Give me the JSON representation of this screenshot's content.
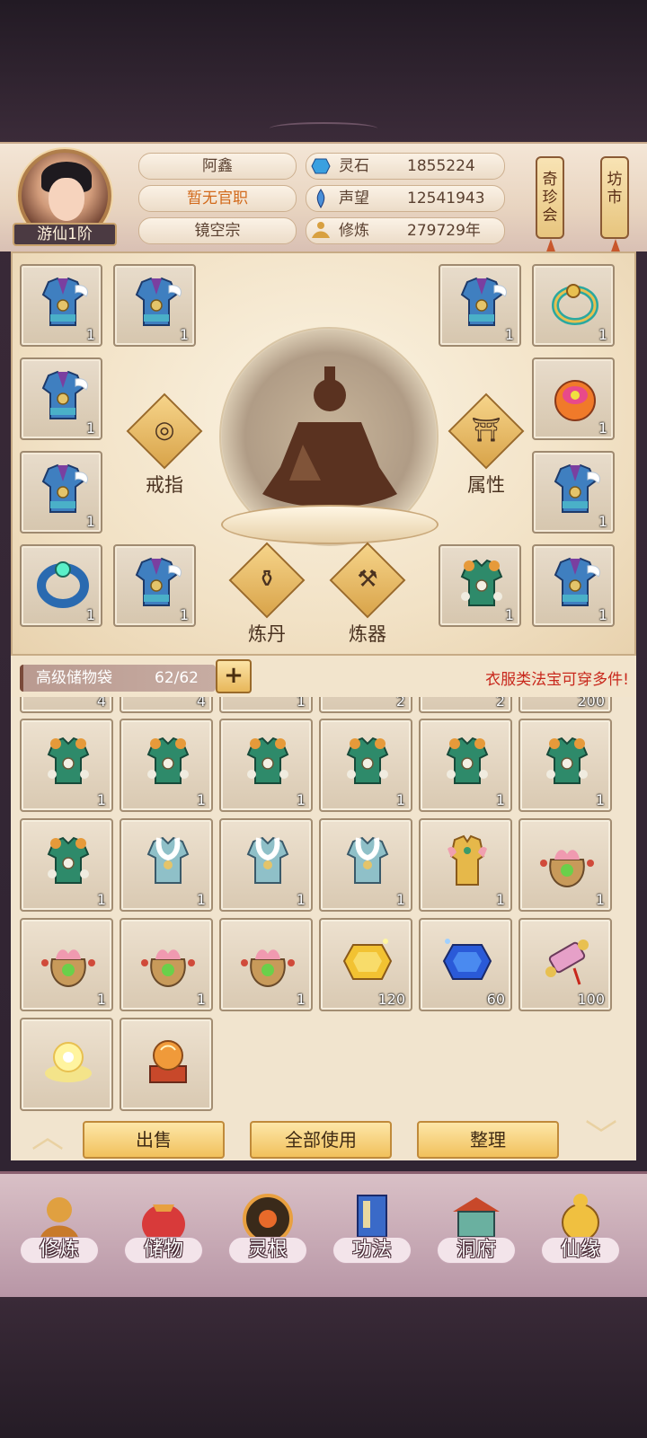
{
  "player": {
    "name": "阿鑫",
    "title": "暂无官职",
    "sect": "镜空宗",
    "rank": "游仙1阶"
  },
  "resources": [
    {
      "icon": "spirit-stone-icon",
      "label": "灵石",
      "value": "1855224",
      "color": "#3aa0e0"
    },
    {
      "icon": "reputation-icon",
      "label": "声望",
      "value": "12541943",
      "color": "#4a8fd8"
    },
    {
      "icon": "cultivate-icon",
      "label": "修炼",
      "value": "279729年",
      "color": "#d8a040"
    }
  ],
  "shops": {
    "treasure": "奇珍会",
    "market": "坊市"
  },
  "equipment": {
    "slots": [
      {
        "icon": "robe-blue-icon",
        "count": "1"
      },
      {
        "icon": "robe-blue-icon",
        "count": "1"
      },
      {
        "icon": "robe-blue-icon",
        "count": "1"
      },
      {
        "icon": "ring-gold-icon",
        "count": "1"
      },
      {
        "icon": "robe-blue-icon",
        "count": "1"
      },
      {
        "icon": "pouch-orange-icon",
        "count": "1"
      },
      {
        "icon": "robe-blue-icon",
        "count": "1"
      },
      {
        "icon": "robe-blue-icon",
        "count": "1"
      },
      {
        "icon": "ring-jade-icon",
        "count": "1"
      },
      {
        "icon": "robe-blue-icon",
        "count": "1"
      },
      {
        "icon": "robe-green-icon",
        "count": "1"
      },
      {
        "icon": "robe-blue-icon",
        "count": "1"
      }
    ],
    "actions": {
      "ring": "戒指",
      "attribute": "属性",
      "alchemy": "炼丹",
      "forge": "炼器"
    }
  },
  "bag": {
    "name": "高级储物袋",
    "capacity": "62/62",
    "tip": "衣服类法宝可穿多件!"
  },
  "inventory": {
    "top_counts": [
      "4",
      "4",
      "1",
      "2",
      "2",
      "200"
    ],
    "rows": [
      [
        {
          "icon": "robe-green-icon",
          "count": "1"
        },
        {
          "icon": "robe-green-icon",
          "count": "1"
        },
        {
          "icon": "robe-green-icon",
          "count": "1"
        },
        {
          "icon": "robe-green-icon",
          "count": "1"
        },
        {
          "icon": "robe-green-icon",
          "count": "1"
        },
        {
          "icon": "robe-green-icon",
          "count": "1"
        }
      ],
      [
        {
          "icon": "robe-green-icon",
          "count": "1"
        },
        {
          "icon": "robe-white-icon",
          "count": "1"
        },
        {
          "icon": "robe-white-icon",
          "count": "1"
        },
        {
          "icon": "robe-white-icon",
          "count": "1"
        },
        {
          "icon": "robe-gold-icon",
          "count": "1"
        },
        {
          "icon": "pouch-lotus-icon",
          "count": "1"
        }
      ],
      [
        {
          "icon": "pouch-lotus-icon",
          "count": "1"
        },
        {
          "icon": "pouch-lotus-icon",
          "count": "1"
        },
        {
          "icon": "pouch-lotus-icon",
          "count": "1"
        },
        {
          "icon": "gem-gold-icon",
          "count": "120"
        },
        {
          "icon": "gem-blue-icon",
          "count": "60"
        },
        {
          "icon": "scroll-icon",
          "count": "100"
        }
      ],
      [
        {
          "icon": "cloud-lamp-icon",
          "count": ""
        },
        {
          "icon": "orb-stand-icon",
          "count": ""
        }
      ]
    ]
  },
  "actions": {
    "sell": "出售",
    "use_all": "全部使用",
    "sort": "整理"
  },
  "nav": [
    {
      "icon": "cultivate-nav-icon",
      "label": "修炼"
    },
    {
      "icon": "storage-nav-icon",
      "label": "储物"
    },
    {
      "icon": "spirit-root-nav-icon",
      "label": "灵根"
    },
    {
      "icon": "technique-nav-icon",
      "label": "功法"
    },
    {
      "icon": "cave-nav-icon",
      "label": "洞府"
    },
    {
      "icon": "fate-nav-icon",
      "label": "仙缘"
    }
  ]
}
